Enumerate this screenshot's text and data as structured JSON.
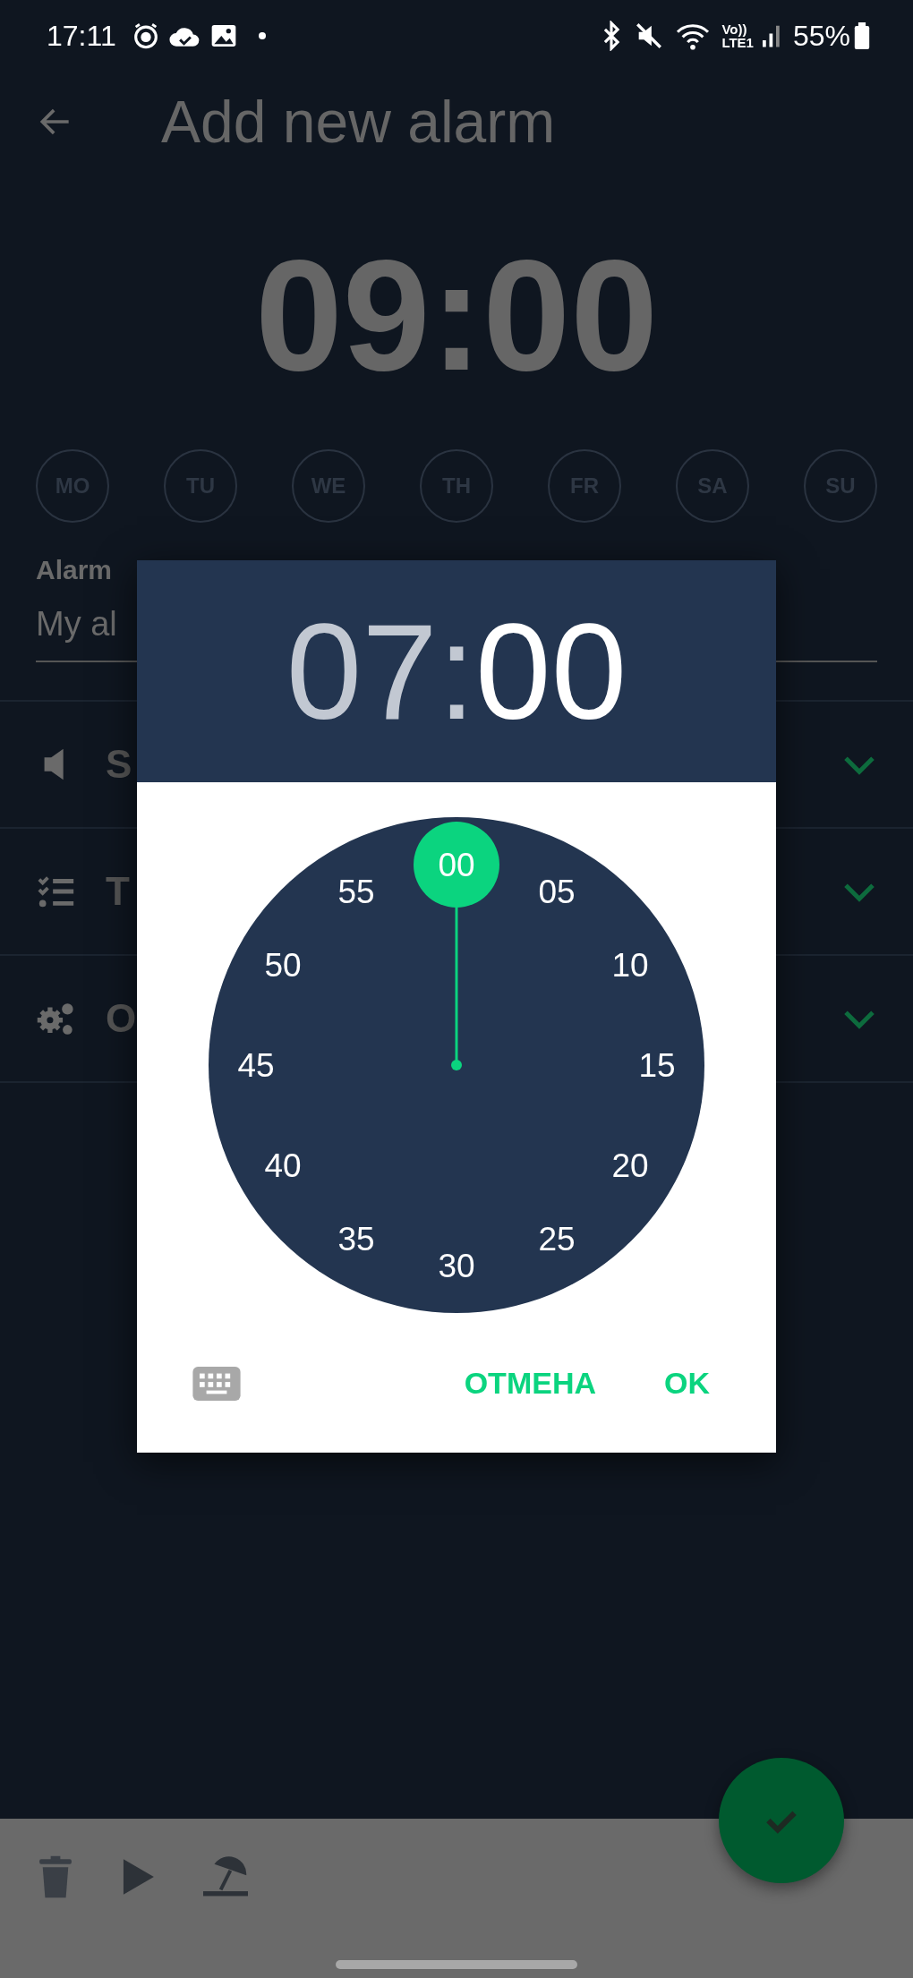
{
  "status_bar": {
    "time": "17:11",
    "volte": "Vo))",
    "network": "LTE1",
    "battery": "55%"
  },
  "header": {
    "title": "Add new alarm"
  },
  "alarm_time": "09:00",
  "days": [
    {
      "label": "MO",
      "selected": false
    },
    {
      "label": "TU",
      "selected": false
    },
    {
      "label": "WE",
      "selected": false
    },
    {
      "label": "TH",
      "selected": false
    },
    {
      "label": "FR",
      "selected": false
    },
    {
      "label": "SA",
      "selected": false
    },
    {
      "label": "SU",
      "selected": false
    }
  ],
  "alarm_name": {
    "label": "Alarm",
    "value": "My al"
  },
  "sections": [
    {
      "kind": "sound",
      "label": "S",
      "expanded": false
    },
    {
      "kind": "tasks",
      "label": "T",
      "expanded": false
    },
    {
      "kind": "options",
      "label": "O",
      "expanded": false
    }
  ],
  "dialog": {
    "hour": {
      "text": "07",
      "selected": false
    },
    "separator": ":",
    "minute": {
      "text": "00",
      "selected": true
    },
    "dial": [
      {
        "label": "00",
        "selected": true
      },
      {
        "label": "05",
        "selected": false
      },
      {
        "label": "10",
        "selected": false
      },
      {
        "label": "15",
        "selected": false
      },
      {
        "label": "20",
        "selected": false
      },
      {
        "label": "25",
        "selected": false
      },
      {
        "label": "30",
        "selected": false
      },
      {
        "label": "35",
        "selected": false
      },
      {
        "label": "40",
        "selected": false
      },
      {
        "label": "45",
        "selected": false
      },
      {
        "label": "50",
        "selected": false
      },
      {
        "label": "55",
        "selected": false
      }
    ],
    "buttons": [
      "ОТМЕНА",
      "OK"
    ]
  }
}
